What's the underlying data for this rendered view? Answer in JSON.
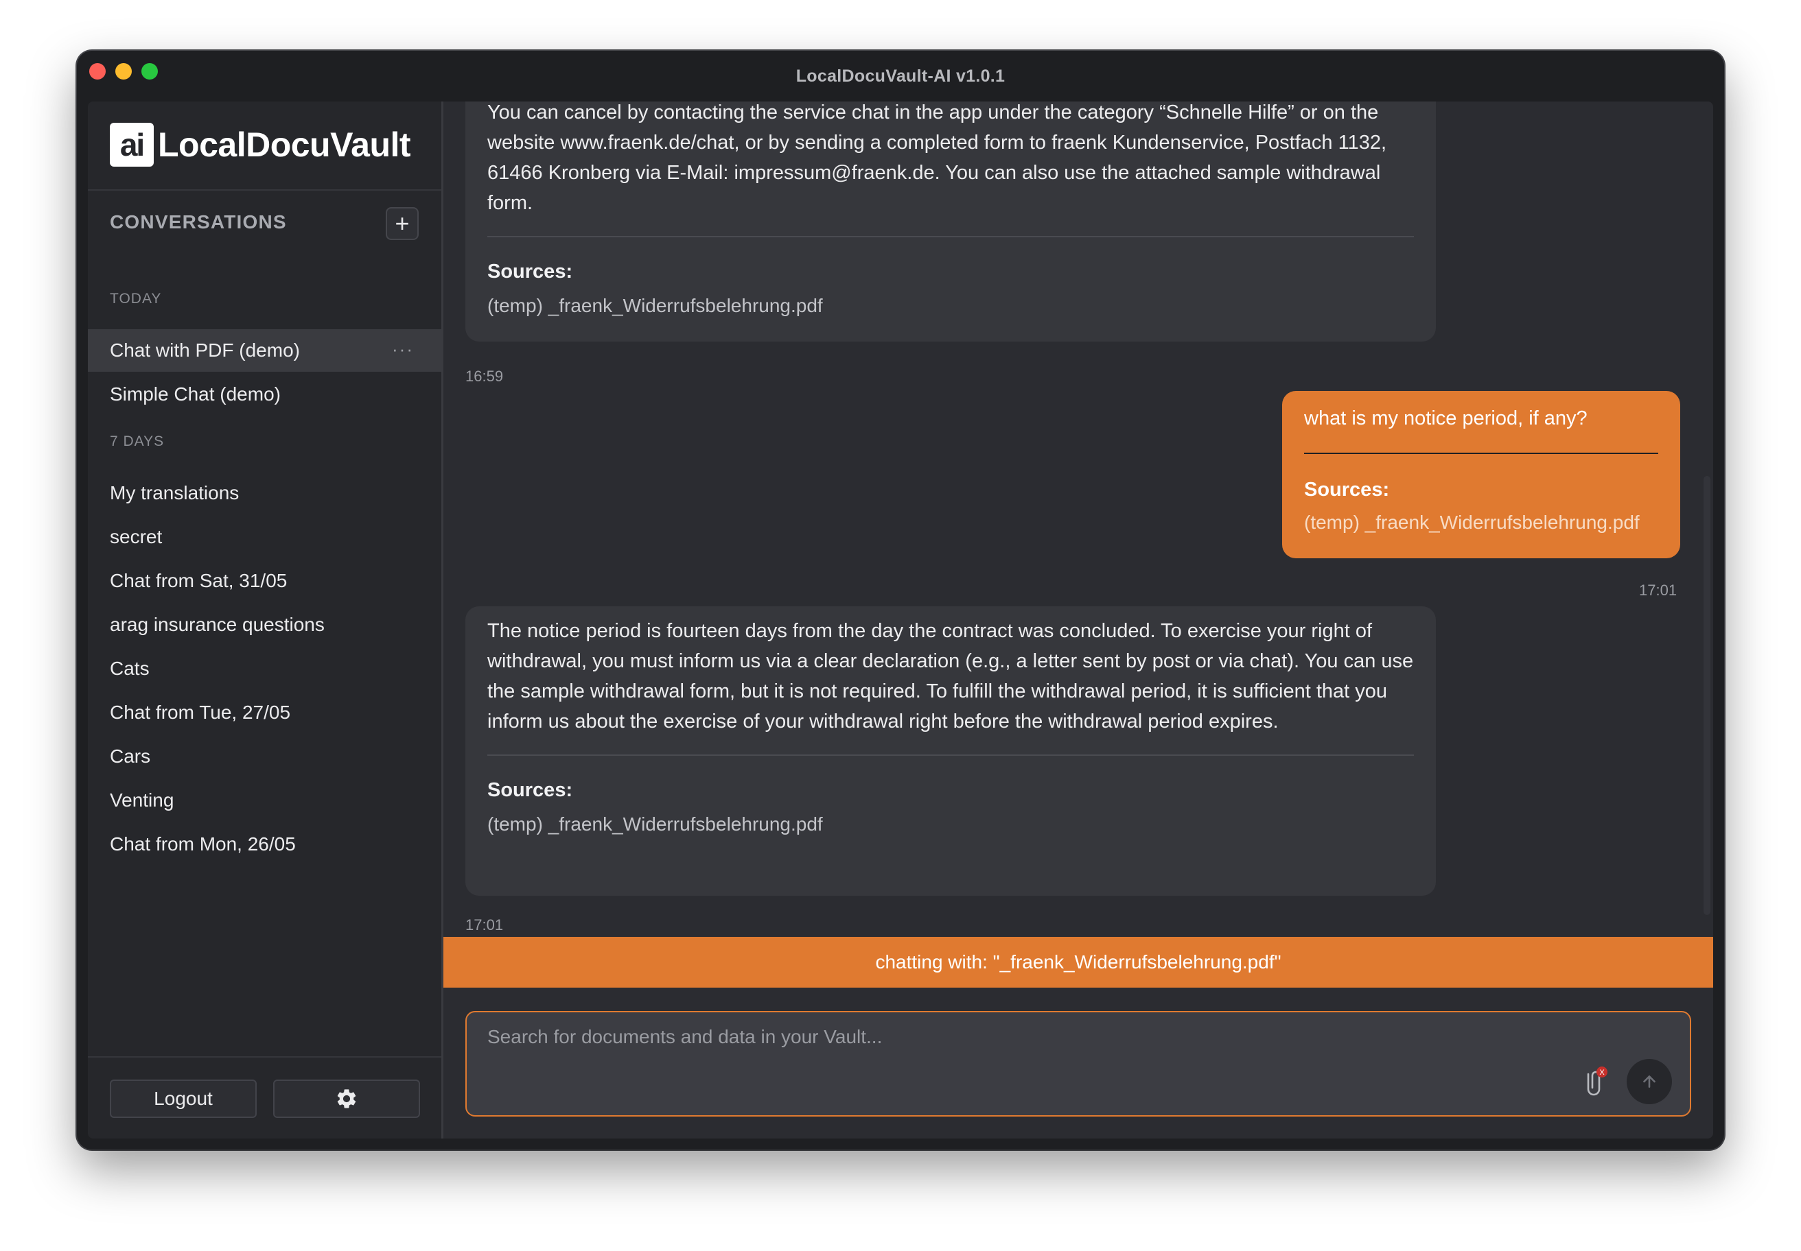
{
  "window": {
    "title": "LocalDocuVault-AI v1.0.1"
  },
  "sidebar": {
    "logo_badge": "ai",
    "logo_text": "LocalDocuVault",
    "conversations_label": "CONVERSATIONS",
    "new_label": "+",
    "sections": [
      {
        "label": "TODAY",
        "items": [
          "Chat with PDF (demo)",
          "Simple Chat (demo)"
        ]
      },
      {
        "label": "7 DAYS",
        "items": [
          "My translations",
          "secret",
          "Chat from Sat, 31/05",
          "arag insurance questions",
          "Cats",
          "Chat from Tue, 27/05",
          "Cars",
          "Venting",
          "Chat from Mon, 26/05"
        ]
      }
    ],
    "more_label": "···",
    "logout_label": "Logout"
  },
  "chat": {
    "messages": [
      {
        "role": "assistant",
        "text": "You can cancel by contacting the service chat in the app under the category “Schnelle Hilfe” or on the website www.fraenk.de/chat, or by sending a completed form to fraenk Kundenservice, Postfach 1132, 61466 Kronberg via E-Mail: impressum@fraenk.de. You can also use the attached sample withdrawal form.",
        "sources_label": "Sources:",
        "source": "(temp) _fraenk_Widerrufsbelehrung.pdf",
        "time": "16:59"
      },
      {
        "role": "user",
        "text": "what is my notice period, if any?",
        "sources_label": "Sources:",
        "source": "(temp) _fraenk_Widerrufsbelehrung.pdf",
        "time": "17:01"
      },
      {
        "role": "assistant",
        "text": "The notice period is fourteen days from the day the contract was concluded. To exercise your right of withdrawal, you must inform us via a clear declaration (e.g., a letter sent by post or via chat). You can use the sample withdrawal form, but it is not required. To fulfill the withdrawal period, it is sufficient that you inform us about the exercise of your withdrawal right before the withdrawal period expires.",
        "sources_label": "Sources:",
        "source": "(temp) _fraenk_Widerrufsbelehrung.pdf",
        "time": "17:01"
      }
    ],
    "banner": "chatting with: \"_fraenk_Widerrufsbelehrung.pdf\"",
    "input": {
      "placeholder": "Search for documents and data in your Vault...",
      "value": ""
    },
    "attach_badge": "X"
  },
  "colors": {
    "accent": "#e07a30",
    "bg": "#2b2c31",
    "sidebar": "#26272b",
    "bubble": "#36373c"
  }
}
